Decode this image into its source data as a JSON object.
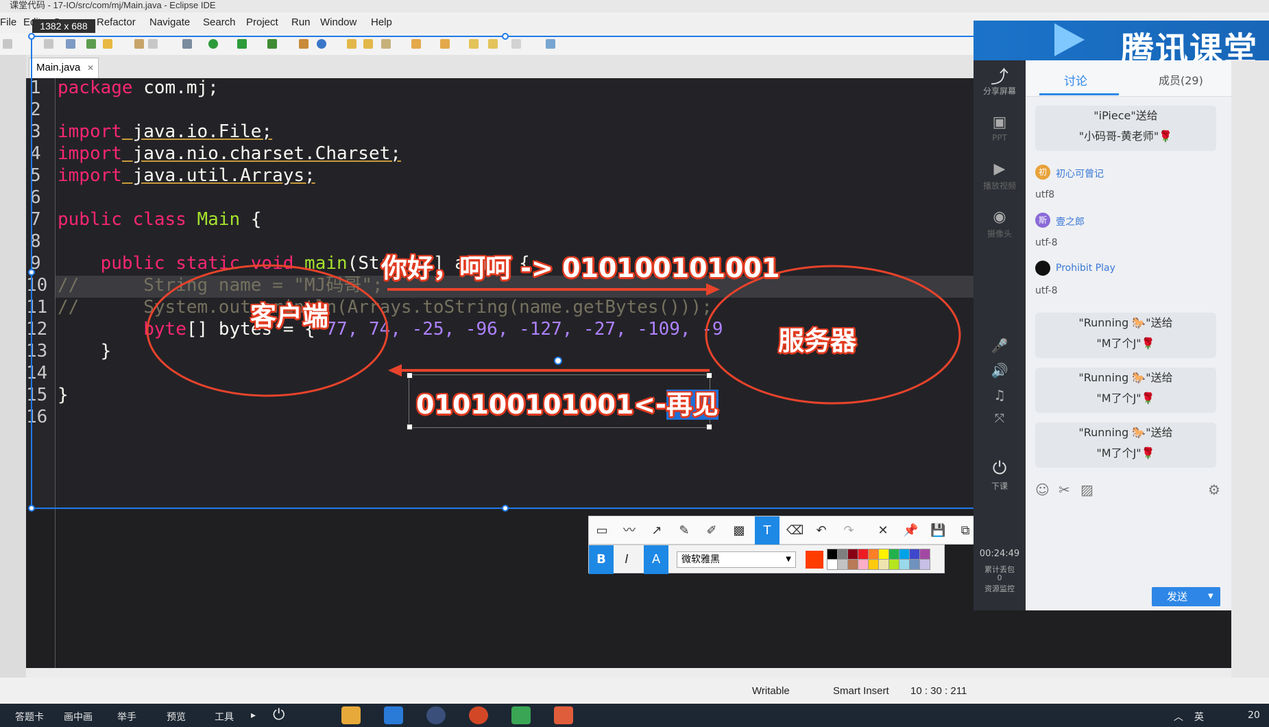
{
  "window": {
    "title": "课堂代码 - 17-IO/src/com/mj/Main.java - Eclipse IDE"
  },
  "menu": [
    "File",
    "Edit",
    "Source",
    "Refactor",
    "Navigate",
    "Search",
    "Project",
    "Run",
    "Window",
    "Help"
  ],
  "selection_size": "1382 x 688",
  "editor": {
    "tab": "Main.java",
    "line_numbers": [
      "1",
      "2",
      "3",
      "4",
      "5",
      "6",
      "7",
      "8",
      "9",
      "10",
      "11",
      "12",
      "13",
      "14",
      "15",
      "16"
    ],
    "lines": {
      "l1_kw": "package",
      "l1_rest": " com.mj;",
      "l3_kw": "import",
      "l3_rest": " java.io.File;",
      "l4_kw": "import",
      "l4_rest": " java.nio.charset.Charset;",
      "l5_kw": "import",
      "l5_rest": " java.util.Arrays;",
      "l7_kw": "public class",
      "l7_cls": " Main",
      "l7_rest": " {",
      "l9_kw": "public static void",
      "l9_fn": " main",
      "l9_rest": "(String[] args) {",
      "l10": "//      String name = \"MJ码哥\";",
      "l11": "//      System.out.println(Arrays.toString(name.getBytes()));",
      "l12_kw": "byte",
      "l12_mid": "[] bytes = { ",
      "l12_nums": "77, 74, -25, -96, -127, -27, -109, -9",
      "l13": "    }",
      "l15": "}"
    }
  },
  "annotations": {
    "top_arrow_text": "你好，呵呵 -> 010100101001",
    "client_label": "客户端",
    "server_label": "服务器",
    "bottom_text_prefix": "010100101001<-",
    "bottom_text_selected": "再见"
  },
  "drawing_toolbar": {
    "font": "微软雅黑",
    "bold": "B",
    "italic": "I",
    "text_color": "A",
    "colors": [
      "#000000",
      "#7f7f7f",
      "#880015",
      "#ed1c24",
      "#ff7f27",
      "#fff200",
      "#22b14c",
      "#00a2e8",
      "#3f48cc",
      "#a349a4",
      "#ffffff",
      "#c3c3c3",
      "#b97a57",
      "#ffaec9",
      "#ffc90e",
      "#efe4b0",
      "#b5e61d",
      "#99d9ea",
      "#7092be",
      "#c8bfe7"
    ],
    "current_color": "#ff3c00"
  },
  "statusbar": {
    "writable": "Writable",
    "insert_mode": "Smart Insert",
    "position": "10 : 30 : 211"
  },
  "tencent": {
    "brand": "腾讯课堂",
    "tabs": {
      "discuss": "讨论",
      "members": "成员(29)"
    },
    "side": {
      "share_screen": "分享屏幕",
      "ppt": "PPT",
      "video": "播放视频",
      "camera": "摄像头",
      "end_class": "下课",
      "timer": "00:24:49",
      "packet_loss": "累计丢包",
      "packet_loss_value": "0",
      "resource_monitor": "资源监控"
    },
    "chat": [
      {
        "type": "gift",
        "line1": "\"iPiece\"送给",
        "line2": "\"小码哥-黄老师\"🌹"
      },
      {
        "type": "msg",
        "user": "初心可曾记",
        "avatar": "初",
        "avatar_color": "#e8a23a",
        "text": "utf8"
      },
      {
        "type": "msg",
        "user": "壹之郎",
        "avatar": "斯",
        "avatar_color": "#8a6ad8",
        "text": "utf-8"
      },
      {
        "type": "msg",
        "user": "Prohibit Play",
        "avatar": "",
        "avatar_color": "#111111",
        "text": "utf-8"
      },
      {
        "type": "gift",
        "line1": "\"Running 🐎\"送给",
        "line2": "\"M了个J\"🌹"
      },
      {
        "type": "gift",
        "line1": "\"Running 🐎\"送给",
        "line2": "\"M了个J\"🌹"
      },
      {
        "type": "gift",
        "line1": "\"Running 🐎\"送给",
        "line2": "\"M了个J\"🌹"
      }
    ],
    "send": "发送"
  },
  "taskbar": {
    "items": [
      "答题卡",
      "画中画",
      "举手",
      "预览",
      "工具"
    ],
    "ime": "英",
    "clock": "20"
  }
}
